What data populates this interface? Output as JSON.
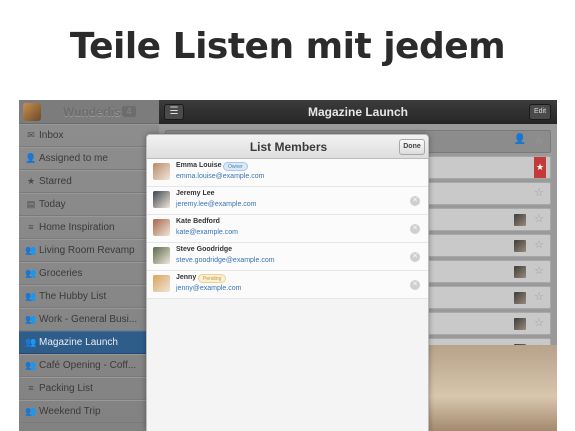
{
  "headline": "Teile Listen mit jedem",
  "sidebar": {
    "app_title": "Wunderlist",
    "badge": "4",
    "items": [
      {
        "label": "Inbox",
        "icon": "inbox-icon",
        "glyph": "✉"
      },
      {
        "label": "Assigned to me",
        "icon": "person-icon",
        "glyph": "👤"
      },
      {
        "label": "Starred",
        "icon": "star-icon",
        "glyph": "★"
      },
      {
        "label": "Today",
        "icon": "calendar-icon",
        "glyph": "▤"
      },
      {
        "label": "Home Inspiration",
        "icon": "list-icon",
        "glyph": "≡"
      },
      {
        "label": "Living Room Revamp",
        "icon": "shared-list-icon",
        "glyph": "👥"
      },
      {
        "label": "Groceries",
        "icon": "shared-list-icon",
        "glyph": "👥"
      },
      {
        "label": "The Hubby List",
        "icon": "shared-list-icon",
        "glyph": "👥"
      },
      {
        "label": "Work - General Busi...",
        "icon": "shared-list-icon",
        "glyph": "👥"
      },
      {
        "label": "Magazine Launch",
        "icon": "shared-list-icon",
        "glyph": "👥"
      },
      {
        "label": "Café Opening - Coff...",
        "icon": "shared-list-icon",
        "glyph": "👥"
      },
      {
        "label": "Packing List",
        "icon": "list-icon",
        "glyph": "≡"
      },
      {
        "label": "Weekend Trip",
        "icon": "shared-list-icon",
        "glyph": "👥"
      }
    ],
    "active_index": 9
  },
  "main": {
    "menu_glyph": "☰",
    "list_title": "Magazine Launch",
    "edit_label": "Edit"
  },
  "modal": {
    "title": "List Members",
    "done_label": "Done",
    "remove_glyph": "✕",
    "members": [
      {
        "name": "Emma Louise",
        "email": "emma.louise@example.com",
        "role": "Owner",
        "avatar_color": "#b98a6a"
      },
      {
        "name": "Jeremy Lee",
        "email": "jeremy.lee@example.com",
        "role": "",
        "avatar_color": "#3e4650"
      },
      {
        "name": "Kate Bedford",
        "email": "kate@example.com",
        "role": "",
        "avatar_color": "#a8674a"
      },
      {
        "name": "Steve Goodridge",
        "email": "steve.goodridge@example.com",
        "role": "",
        "avatar_color": "#5a6a4a"
      },
      {
        "name": "Jenny",
        "email": "jenny@example.com",
        "role": "Pending",
        "avatar_color": "#d8a35a"
      }
    ]
  },
  "colors": {
    "active_item": "#2f5d8a",
    "link": "#3a73b5",
    "starred_flag": "#c23a3a"
  }
}
